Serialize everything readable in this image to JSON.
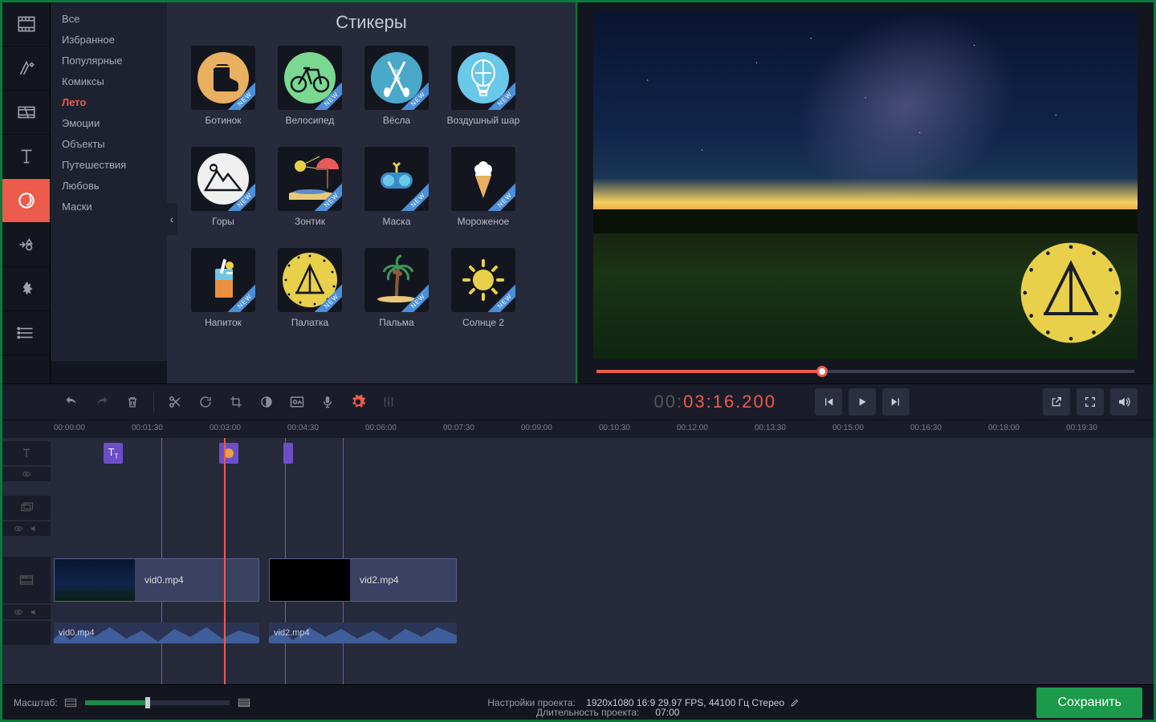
{
  "panel_title": "Стикеры",
  "categories": [
    "Все",
    "Избранное",
    "Популярные",
    "Комиксы",
    "Лето",
    "Эмоции",
    "Объекты",
    "Путешествия",
    "Любовь",
    "Маски"
  ],
  "selected_category": "Лето",
  "stickers": [
    {
      "label": "Ботинок",
      "new": true,
      "icon": "boot"
    },
    {
      "label": "Велосипед",
      "new": true,
      "icon": "bike"
    },
    {
      "label": "Вёсла",
      "new": true,
      "icon": "oars"
    },
    {
      "label": "Воздушный шар",
      "new": true,
      "icon": "balloon"
    },
    {
      "label": "Горы",
      "new": true,
      "icon": "mountain"
    },
    {
      "label": "Зонтик",
      "new": true,
      "icon": "umbrella"
    },
    {
      "label": "Маска",
      "new": true,
      "icon": "mask"
    },
    {
      "label": "Мороженое",
      "new": true,
      "icon": "icecream"
    },
    {
      "label": "Напиток",
      "new": true,
      "icon": "drink"
    },
    {
      "label": "Палатка",
      "new": true,
      "icon": "tent"
    },
    {
      "label": "Пальма",
      "new": true,
      "icon": "palm"
    },
    {
      "label": "Солнце 2",
      "new": true,
      "icon": "sun"
    }
  ],
  "new_label": "NEW",
  "timecode": {
    "gray": "00:",
    "orange": "03:16.200"
  },
  "ruler": [
    "00:00:00",
    "00:01:30",
    "00:03:00",
    "00:04:30",
    "00:06:00",
    "00:07:30",
    "00:09:00",
    "00:10:30",
    "00:12:00",
    "00:13:30",
    "00:15:00",
    "00:16:30",
    "00:18:00",
    "00:19:30"
  ],
  "clips": {
    "vid0": "vid0.mp4",
    "vid2": "vid2.mp4",
    "aud0": "vid0.mp4",
    "aud2": "vid2.mp4"
  },
  "zoom_label": "Масштаб:",
  "settings_label": "Настройки проекта:",
  "settings_value": "1920x1080 16:9 29.97 FPS, 44100 Гц Стерео",
  "duration_label": "Длительность проекта:",
  "duration_value": "07:00",
  "save_label": "Сохранить"
}
